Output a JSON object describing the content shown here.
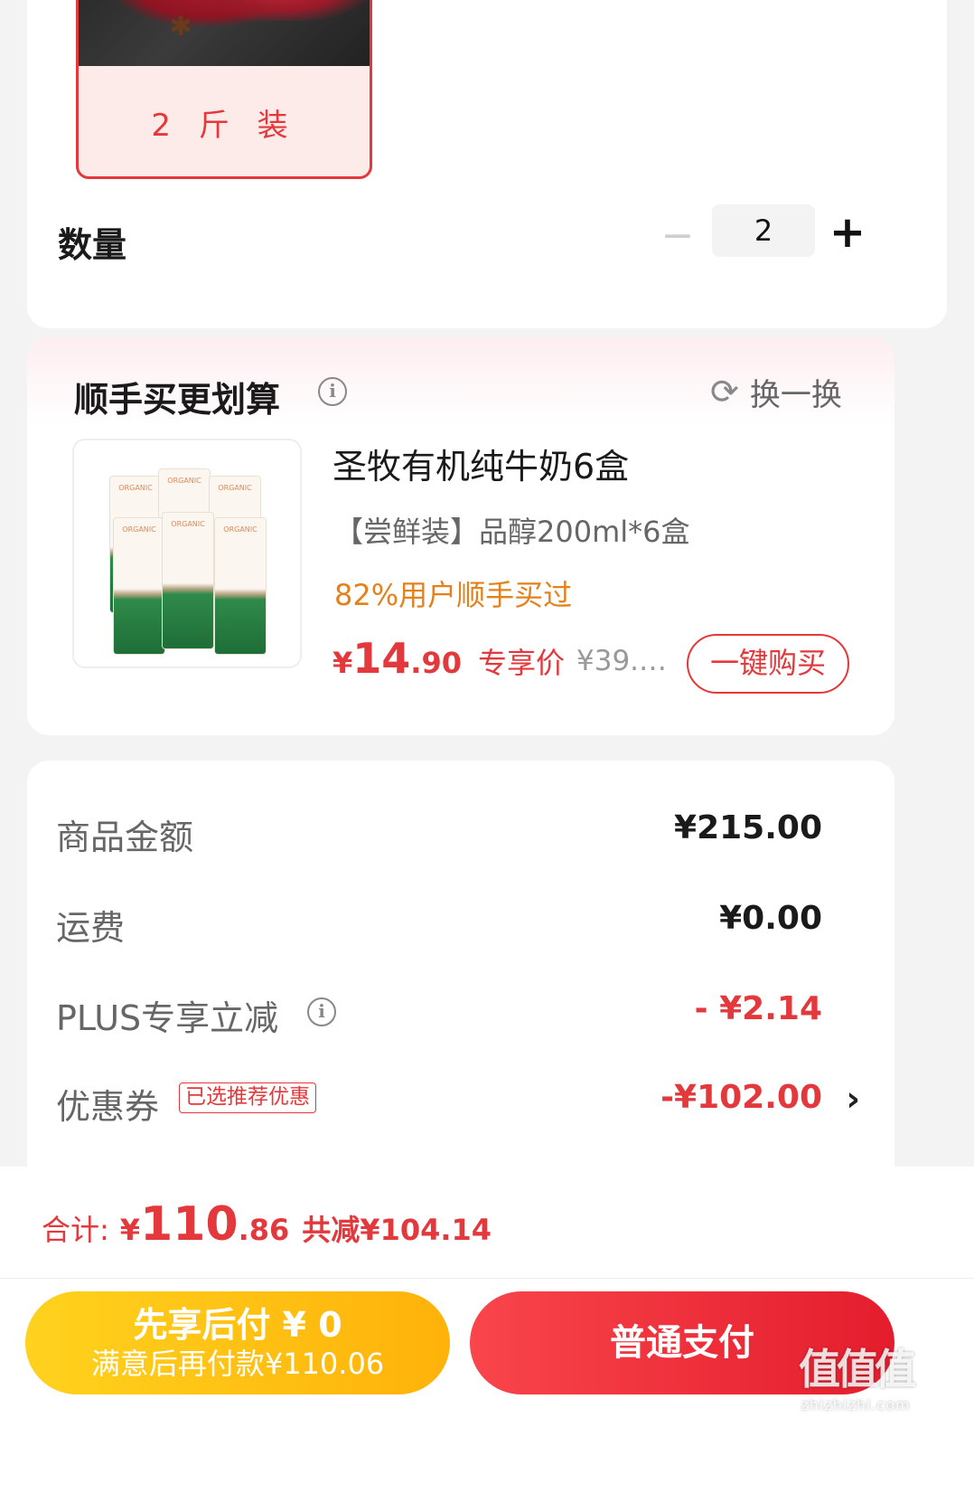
{
  "spec": {
    "option_label": "2 斤 装"
  },
  "quantity": {
    "label": "数量",
    "minus": "−",
    "value": "2",
    "plus": "+"
  },
  "recommend": {
    "title": "顺手买更划算",
    "info_icon": "i",
    "swap_label": "换一换",
    "product": {
      "image_brand": "ORGANIC",
      "name": "圣牧有机纯牛奶6盒",
      "spec": "【尝鲜装】品醇200ml*6盒",
      "tip": "82%用户顺手买过",
      "price_symbol": "¥",
      "price_int": "14",
      "price_dec": ".90",
      "price_tag": "专享价",
      "original_price": "¥39.…",
      "buy_label": "一键购买"
    }
  },
  "amounts": {
    "goods": {
      "label": "商品金额",
      "value": "¥215.00"
    },
    "shipping": {
      "label": "运费",
      "value": "¥0.00"
    },
    "plus": {
      "label": "PLUS专享立减",
      "value": "- ¥2.14"
    },
    "coupon": {
      "label": "优惠券",
      "badge": "已选推荐优惠",
      "value": "-¥102.00",
      "chevron": "›"
    }
  },
  "total": {
    "label": "合计:",
    "symbol": "¥",
    "int": "110",
    "dec": ".86",
    "saving": "共减¥104.14"
  },
  "actions": {
    "pay_later_title": "先享后付 ¥ 0",
    "pay_later_sub": "满意后再付款¥110.06",
    "pay_normal": "普通支付"
  },
  "watermark": {
    "logo": "值值值",
    "site": "zhizhizhi.com"
  },
  "colors": {
    "accent": "#e4393c",
    "orange": "#e4811c",
    "yellow": "#ffc21a"
  }
}
